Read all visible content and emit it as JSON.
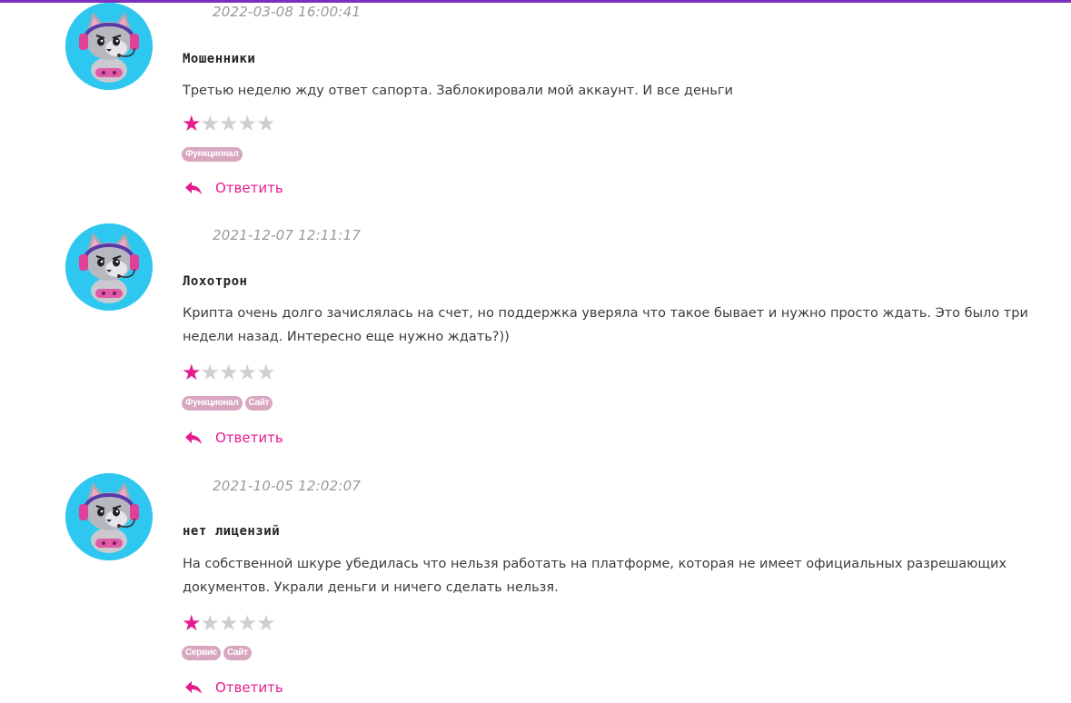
{
  "colors": {
    "accent": "#e51c8e",
    "top_bar": "#7b2fbe",
    "avatar_bg": "#2ec7f0",
    "tag_bg": "#d9a6bf",
    "star_empty": "#cfcfcf"
  },
  "reviews": [
    {
      "date": "2022-03-08 16:00:41",
      "title": "Мошенники",
      "text": "Третью неделю жду ответ сапорта. Заблокировали мой аккаунт. И все деньги",
      "rating": 1,
      "rating_max": 5,
      "tags": [
        "Функционал"
      ],
      "reply_label": "Ответить",
      "avatar_icon": "cat-gamer-avatar-icon",
      "reply_icon": "reply-arrow-icon"
    },
    {
      "date": "2021-12-07 12:11:17",
      "title": "Лохотрон",
      "text": "Крипта очень долго зачислялась на счет, но поддержка уверяла что такое бывает и нужно просто ждать. Это было три недели назад. Интересно еще нужно ждать?))",
      "rating": 1,
      "rating_max": 5,
      "tags": [
        "Функционал",
        "Сайт"
      ],
      "reply_label": "Ответить",
      "avatar_icon": "cat-gamer-avatar-icon",
      "reply_icon": "reply-arrow-icon"
    },
    {
      "date": "2021-10-05 12:02:07",
      "title": "нет лицензий",
      "text": "На собственной шкуре убедилась что нельзя работать на платформе, которая не имеет официальных разрешающих документов. Украли деньги и ничего сделать нельзя.",
      "rating": 1,
      "rating_max": 5,
      "tags": [
        "Сервис",
        "Сайт"
      ],
      "reply_label": "Ответить",
      "avatar_icon": "cat-gamer-avatar-icon",
      "reply_icon": "reply-arrow-icon"
    }
  ]
}
